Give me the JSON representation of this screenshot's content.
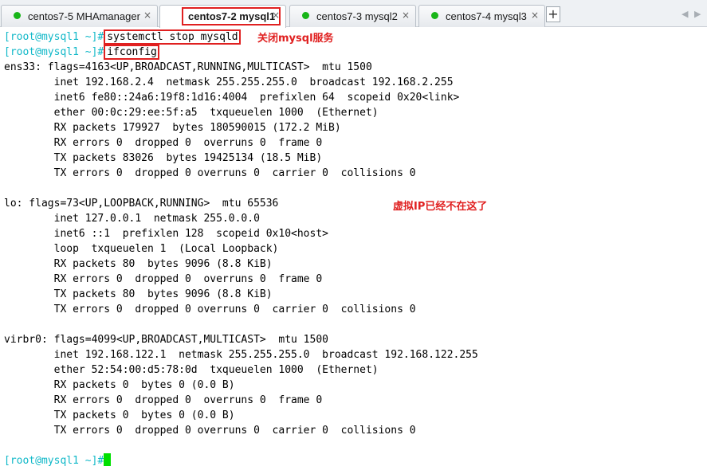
{
  "tabs": [
    {
      "label": "centos7-5 MHAmanager",
      "close": "×",
      "dot_color": "#18b518",
      "active": false
    },
    {
      "label": "centos7-2 mysql1",
      "close": "×",
      "dot_color": "#18b518",
      "active": true
    },
    {
      "label": "centos7-3 mysql2",
      "close": "×",
      "dot_color": "#18b518",
      "active": false
    },
    {
      "label": "centos7-4 mysql3",
      "close": "×",
      "dot_color": "#18b518",
      "active": false
    }
  ],
  "add_tab": "+",
  "nav": {
    "prev": "◀",
    "next": "▶"
  },
  "terminal": {
    "prompt": "[root@mysql1 ~]#",
    "cmd1": "systemctl stop mysqld",
    "cmd2": "ifconfig",
    "output": [
      "ens33: flags=4163<UP,BROADCAST,RUNNING,MULTICAST>  mtu 1500",
      "        inet 192.168.2.4  netmask 255.255.255.0  broadcast 192.168.2.255",
      "        inet6 fe80::24a6:19f8:1d16:4004  prefixlen 64  scopeid 0x20<link>",
      "        ether 00:0c:29:ee:5f:a5  txqueuelen 1000  (Ethernet)",
      "        RX packets 179927  bytes 180590015 (172.2 MiB)",
      "        RX errors 0  dropped 0  overruns 0  frame 0",
      "        TX packets 83026  bytes 19425134 (18.5 MiB)",
      "        TX errors 0  dropped 0 overruns 0  carrier 0  collisions 0",
      "",
      "lo: flags=73<UP,LOOPBACK,RUNNING>  mtu 65536",
      "        inet 127.0.0.1  netmask 255.0.0.0",
      "        inet6 ::1  prefixlen 128  scopeid 0x10<host>",
      "        loop  txqueuelen 1  (Local Loopback)",
      "        RX packets 80  bytes 9096 (8.8 KiB)",
      "        RX errors 0  dropped 0  overruns 0  frame 0",
      "        TX packets 80  bytes 9096 (8.8 KiB)",
      "        TX errors 0  dropped 0 overruns 0  carrier 0  collisions 0",
      "",
      "virbr0: flags=4099<UP,BROADCAST,MULTICAST>  mtu 1500",
      "        inet 192.168.122.1  netmask 255.255.255.0  broadcast 192.168.122.255",
      "        ether 52:54:00:d5:78:0d  txqueuelen 1000  (Ethernet)",
      "        RX packets 0  bytes 0 (0.0 B)",
      "        RX errors 0  dropped 0  overruns 0  frame 0",
      "        TX packets 0  bytes 0 (0.0 B)",
      "        TX errors 0  dropped 0 overruns 0  carrier 0  collisions 0",
      ""
    ],
    "annotation1": "关闭mysql服务",
    "annotation2": "虚拟IP已经不在这了"
  },
  "colors": {
    "prompt": "#10b8c8",
    "annotation": "#e02020",
    "cursor": "#00e000",
    "status_dot": "#18b518"
  }
}
